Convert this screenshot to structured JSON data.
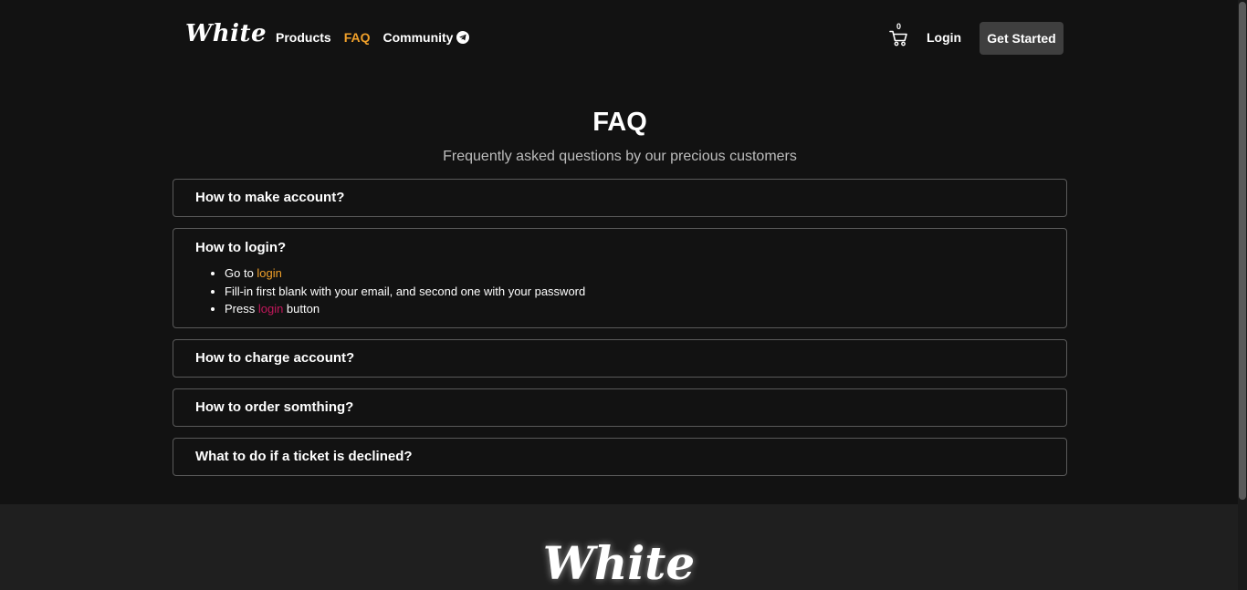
{
  "nav": {
    "brand": "White",
    "links": [
      "Products",
      "FAQ",
      "Community"
    ],
    "active_link": "FAQ",
    "cart_count": "0",
    "login_label": "Login",
    "get_started_label": "Get Started"
  },
  "faq": {
    "title": "FAQ",
    "subtitle": "Frequently asked questions by our precious customers",
    "items": [
      {
        "question": "How to make account?"
      },
      {
        "question": "How to login?",
        "answer": {
          "step1_prefix": "Go to ",
          "step1_link": "login",
          "step2": "Fill-in first blank with your email, and second one with your password",
          "step3_prefix": "Press ",
          "step3_link": "login",
          "step3_suffix": " button"
        }
      },
      {
        "question": "How to charge account?"
      },
      {
        "question": "How to order somthing?"
      },
      {
        "question": "What to do if a ticket is declined?"
      }
    ]
  },
  "footer": {
    "brand": "White"
  },
  "icons": {
    "cart": "shopping-cart-icon",
    "community": "telegram-icon"
  },
  "colors": {
    "background": "#121212",
    "accent": "#f0a02a",
    "link_red": "#c2185b",
    "button_bg": "#3f3f3f",
    "footer_bg": "#1f1f1f"
  }
}
